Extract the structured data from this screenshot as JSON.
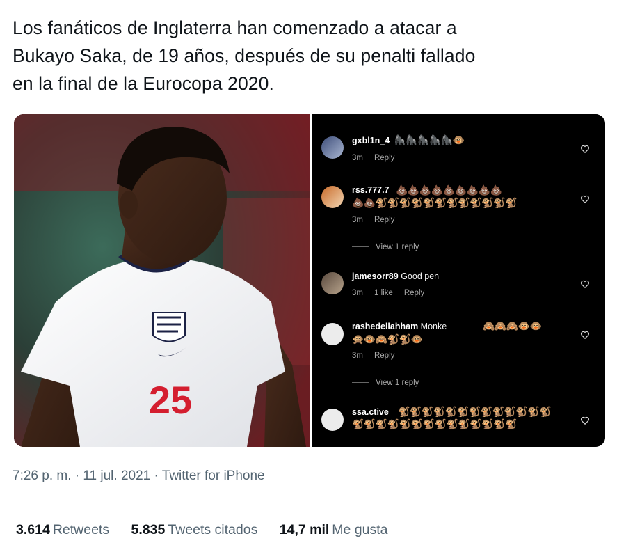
{
  "tweet": {
    "text_line1": "Los fanáticos de Inglaterra han comenzado a atacar a",
    "text_line2": "Bukayo Saka, de 19 años, después de su penalti fallado",
    "text_line3": "en la final de la Eurocopa 2020."
  },
  "photo": {
    "shirt_number": "25"
  },
  "comments": [
    {
      "username": "gxbl1n_4",
      "text": "",
      "emoji_line1": "🦍🦍🦍🦍🦍🐵",
      "emoji_line2": "",
      "time": "3m",
      "likes": "",
      "reply": "Reply",
      "view_replies": ""
    },
    {
      "username": "rss.777.7",
      "text": "",
      "emoji_line1": "💩💩💩💩💩💩💩💩💩",
      "emoji_line2": "💩💩🐒🐒🐒🐒🐒🐒🐒🐒🐒🐒🐒🐒",
      "time": "3m",
      "likes": "",
      "reply": "Reply",
      "view_replies": "View 1 reply"
    },
    {
      "username": "jamesorr89",
      "text": "Good pen",
      "emoji_line1": "",
      "emoji_line2": "",
      "time": "3m",
      "likes": "1 like",
      "reply": "Reply",
      "view_replies": ""
    },
    {
      "username": "rashedellahham",
      "text": "Monke",
      "emoji_line1": "🙈🙈🙈🐵🐵",
      "emoji_line2": "🙊🐵🙈🐒🐒🐵",
      "time": "3m",
      "likes": "",
      "reply": "Reply",
      "view_replies": "View 1 reply"
    },
    {
      "username": "ssa.ctive",
      "text": "",
      "emoji_line1": "🐒🐒🐒🐒🐒🐒🐒🐒🐒🐒🐒🐒🐒",
      "emoji_line2": "🐒🐒🐒🐒🐒🐒🐒🐒🐒🐒🐒🐒🐒🐒",
      "time": "",
      "likes": "",
      "reply": "",
      "view_replies": ""
    }
  ],
  "footer": {
    "timestamp": "7:26 p. m. · 11 jul. 2021 · ",
    "source": "Twitter for iPhone"
  },
  "stats": {
    "retweets_count": "3.614",
    "retweets_label": "Retweets",
    "quotes_count": "5.835",
    "quotes_label": "Tweets citados",
    "likes_count": "14,7 mil",
    "likes_label": "Me gusta"
  },
  "colors": {
    "text_primary": "#0f1419",
    "text_secondary": "#536471",
    "comment_bg": "#000000",
    "comment_meta": "#a8a8a8"
  }
}
